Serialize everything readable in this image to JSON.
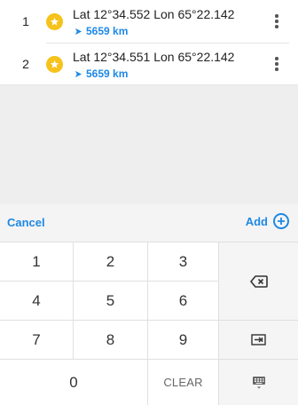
{
  "points": [
    {
      "index": "1",
      "coords": "Lat 12°34.552 Lon 65°22.142",
      "distance": "5659 km"
    },
    {
      "index": "2",
      "coords": "Lat 12°34.551 Lon 65°22.142",
      "distance": "5659 km"
    }
  ],
  "actions": {
    "cancel_label": "Cancel",
    "add_label": "Add"
  },
  "keypad": {
    "k1": "1",
    "k2": "2",
    "k3": "3",
    "k4": "4",
    "k5": "5",
    "k6": "6",
    "k7": "7",
    "k8": "8",
    "k9": "9",
    "k0": "0",
    "clear": "CLEAR"
  },
  "icons": {
    "favorite": "star-icon",
    "distance": "direction-arrow-icon",
    "menu": "more-vert-icon",
    "add": "add-circle-icon",
    "backspace": "backspace-icon",
    "tab": "tab-icon",
    "keyboard": "keyboard-icon"
  },
  "colors": {
    "accent": "#1e88e5",
    "star": "#f6c21c",
    "empty_area": "#eeeeee",
    "action_bar": "#f4f4f4"
  }
}
